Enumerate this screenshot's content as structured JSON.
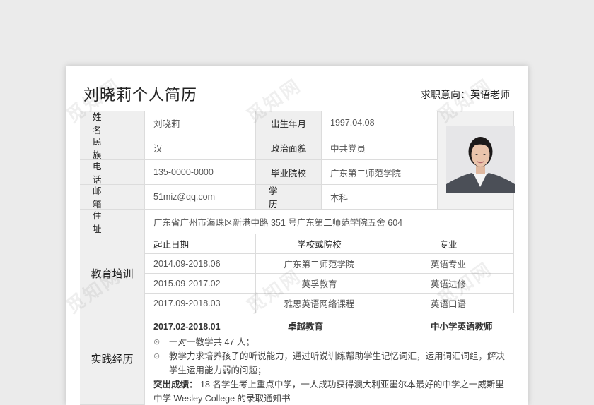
{
  "resume": {
    "title": "刘晓莉个人简历",
    "objective": "求职意向：英语老师",
    "info": {
      "name_label": "姓 名",
      "name": "刘晓莉",
      "birth_label": "出生年月",
      "birth": "1997.04.08",
      "ethnicity_label": "民 族",
      "ethnicity": "汉",
      "politics_label": "政治面貌",
      "politics": "中共党员",
      "phone_label": "电 话",
      "phone": "135-0000-0000",
      "school_label": "毕业院校",
      "school": "广东第二师范学院",
      "email_label": "邮 箱",
      "email": "51miz@qq.com",
      "degree_label": "学 历",
      "degree": "本科",
      "address_label": "住 址",
      "address": "广东省广州市海珠区新港中路 351 号广东第二师范学院五舍 604"
    },
    "education": {
      "label": "教育培训",
      "headers": [
        "起止日期",
        "学校或院校",
        "专业"
      ],
      "rows": [
        [
          "2014.09-2018.06",
          "广东第二师范学院",
          "英语专业"
        ],
        [
          "2015.09-2017.02",
          "英孚教育",
          "英语进修"
        ],
        [
          "2017.09-2018.03",
          "雅思英语网络课程",
          "英语口语"
        ]
      ]
    },
    "practice": {
      "label": "实践经历",
      "period": "2017.02-2018.01",
      "org": "卓越教育",
      "role": "中小学英语教师",
      "bullet_symbol": "⊙",
      "bullets": [
        "一对一教学共 47 人；",
        "教学力求培养孩子的听说能力，通过听说训练帮助学生记忆词汇，运用词汇词组，解决学生运用能力弱的问题；"
      ],
      "highlight_label": "突出成绩：",
      "highlight_text": "18 名学生考上重点中学，一人成功获得澳大利亚墨尔本最好的中学之一威斯里中学 Wesley College 的录取通知书"
    }
  },
  "watermark": "觅知网"
}
